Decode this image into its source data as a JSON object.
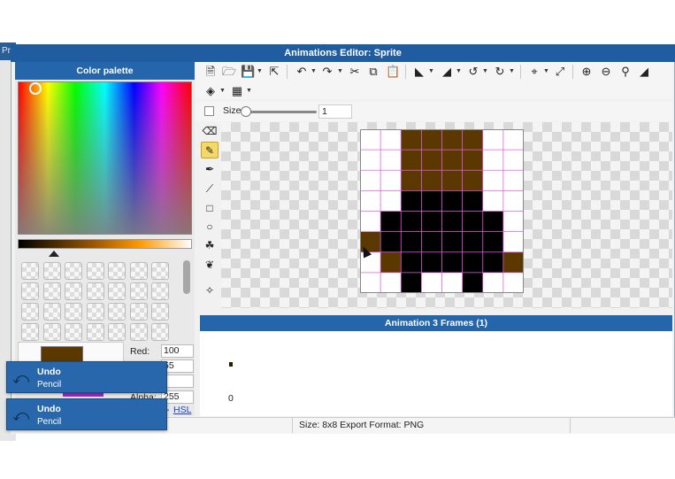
{
  "background_window": {
    "title_fragment": "Pr"
  },
  "window": {
    "title": "Animations Editor: Sprite"
  },
  "palette": {
    "title": "Color palette",
    "red_label": "Red:",
    "red_value": "100",
    "green_value": "55",
    "blue_value": "",
    "alpha_label": "Alpha:",
    "alpha_value": "255",
    "hsl_dash": "-",
    "hsl_link": "HSL",
    "current_color": "#5a3800"
  },
  "toolbar": {
    "icons": [
      "new-file-icon",
      "open-folder-icon",
      "save-icon",
      "export-icon",
      "undo-icon",
      "redo-icon",
      "cut-icon",
      "copy-icon",
      "paste-icon",
      "flip-horizontal-icon",
      "flip-vertical-icon",
      "rotate-left-icon",
      "rotate-right-icon",
      "crop-icon",
      "resize-icon",
      "zoom-in-icon",
      "zoom-out-icon",
      "zoom-fit-icon",
      "swap-colors-icon",
      "layers-icon",
      "grid-icon"
    ]
  },
  "size": {
    "label": "Size",
    "value": "1"
  },
  "tools": [
    "eraser-icon",
    "pencil-icon",
    "brush-icon",
    "line-icon",
    "rectangle-icon",
    "ellipse-icon",
    "fill-bucket-icon",
    "eyedropper-icon",
    "select-icon"
  ],
  "sprite": {
    "width": 8,
    "height": 8,
    "colors": {
      "b": "#5a3800",
      "k": "#000000",
      ".": "transparent"
    },
    "rows": [
      "..bbbb..",
      "..bbbb..",
      "..bbbb..",
      "..kkkk..",
      ".kkkkkk.",
      "bkkkkkk.",
      ".bkkkkkb",
      "..k..k.."
    ]
  },
  "animation": {
    "title": "Animation 3 Frames (1)",
    "frame_number": "0"
  },
  "status": {
    "text": "Size: 8x8   Export Format: PNG"
  },
  "toasts": [
    {
      "title": "Undo",
      "subtitle": "Pencil"
    },
    {
      "title": "Undo",
      "subtitle": "Pencil"
    }
  ]
}
